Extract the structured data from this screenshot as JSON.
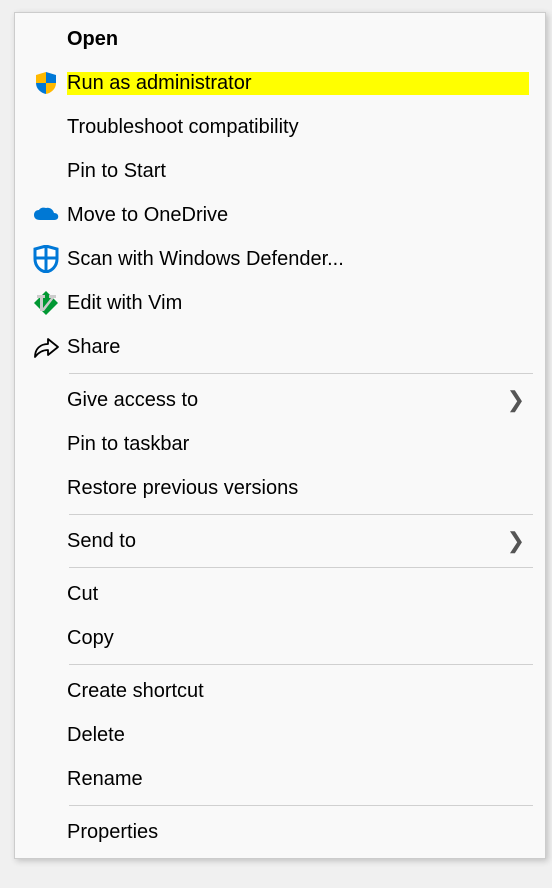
{
  "menu": {
    "open": "Open",
    "run_admin": "Run as administrator",
    "troubleshoot": "Troubleshoot compatibility",
    "pin_start": "Pin to Start",
    "move_onedrive": "Move to OneDrive",
    "scan_defender": "Scan with Windows Defender...",
    "edit_vim": "Edit with Vim",
    "share": "Share",
    "give_access": "Give access to",
    "pin_taskbar": "Pin to taskbar",
    "restore_versions": "Restore previous versions",
    "send_to": "Send to",
    "cut": "Cut",
    "copy": "Copy",
    "create_shortcut": "Create shortcut",
    "delete": "Delete",
    "rename": "Rename",
    "properties": "Properties"
  }
}
